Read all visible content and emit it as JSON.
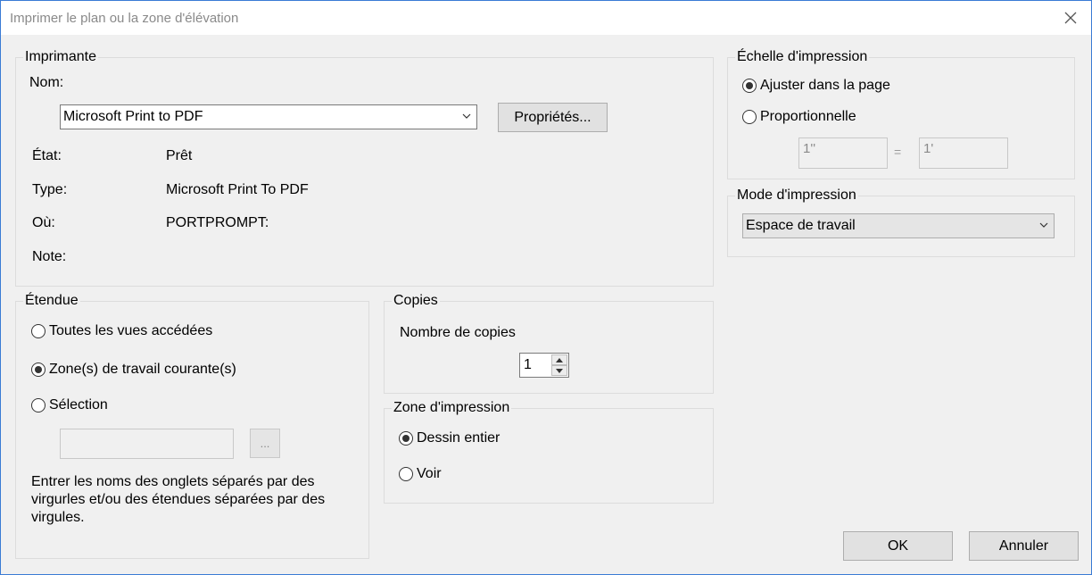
{
  "window": {
    "title": "Imprimer le plan ou la zone d'élévation"
  },
  "printer": {
    "legend": "Imprimante",
    "name_label": "Nom:",
    "name_value": "Microsoft Print to PDF",
    "properties_label": "Propriétés...",
    "state_label": "État:",
    "state_value": "Prêt",
    "type_label": "Type:",
    "type_value": "Microsoft Print To PDF",
    "where_label": "Où:",
    "where_value": "PORTPROMPT:",
    "note_label": "Note:"
  },
  "scale": {
    "legend": "Échelle d'impression",
    "fit_label": "Ajuster dans la page",
    "proportional_label": "Proportionnelle",
    "left_value": "1''",
    "equals": "=",
    "right_value": "1'"
  },
  "mode": {
    "legend": "Mode d'impression",
    "value": "Espace de travail"
  },
  "range": {
    "legend": "Étendue",
    "all_views_label": "Toutes les vues accédées",
    "current_zones_label": "Zone(s) de travail courante(s)",
    "selection_label": "Sélection",
    "browse_label": "...",
    "help_text": "Entrer les noms des onglets séparés par des virgurles et/ou des étendues séparées par des virgules."
  },
  "copies": {
    "legend": "Copies",
    "count_label": "Nombre de copies",
    "count_value": "1"
  },
  "print_zone": {
    "legend": "Zone d'impression",
    "whole_drawing_label": "Dessin entier",
    "view_label": "Voir"
  },
  "actions": {
    "ok_label": "OK",
    "cancel_label": "Annuler"
  },
  "icons": {
    "close": "close-icon",
    "dropdown": "chevron-down-icon",
    "spin_up": "triangle-up-icon",
    "spin_down": "triangle-down-icon"
  }
}
